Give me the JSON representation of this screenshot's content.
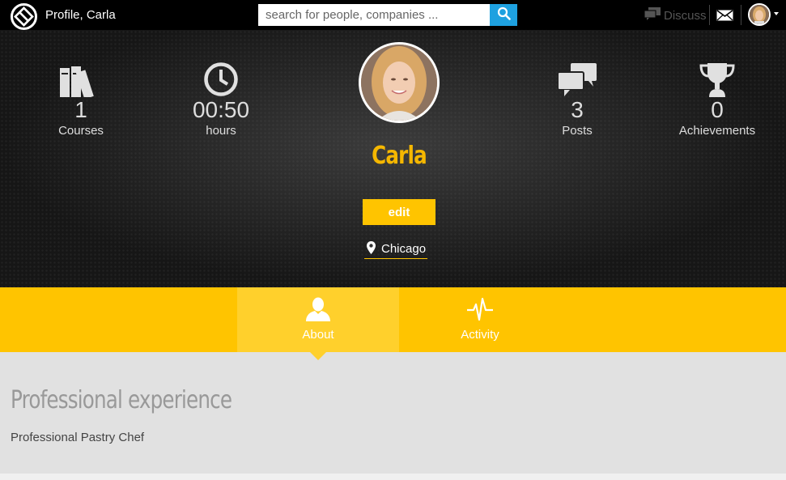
{
  "header": {
    "title": "Profile, Carla",
    "search_placeholder": "search for people, companies ...",
    "discuss_label": "Discuss"
  },
  "stats": [
    {
      "icon": "books-icon",
      "value": "1",
      "label": "Courses"
    },
    {
      "icon": "clock-icon",
      "value": "00:50",
      "label": "hours"
    },
    {
      "icon": "chat-icon",
      "value": "3",
      "label": "Posts"
    },
    {
      "icon": "trophy-icon",
      "value": "0",
      "label": "Achievements"
    }
  ],
  "profile": {
    "name": "Carla",
    "edit_label": "edit",
    "location": "Chicago"
  },
  "tabs": [
    {
      "label": "About",
      "icon": "person-icon",
      "active": true
    },
    {
      "label": "Activity",
      "icon": "pulse-icon",
      "active": false
    }
  ],
  "about": {
    "heading": "Professional experience",
    "text": "Professional Pastry Chef"
  },
  "colors": {
    "accent": "#ffc400",
    "name": "#f5b700",
    "search_button": "#1ea1e0",
    "topbar": "#000000"
  }
}
